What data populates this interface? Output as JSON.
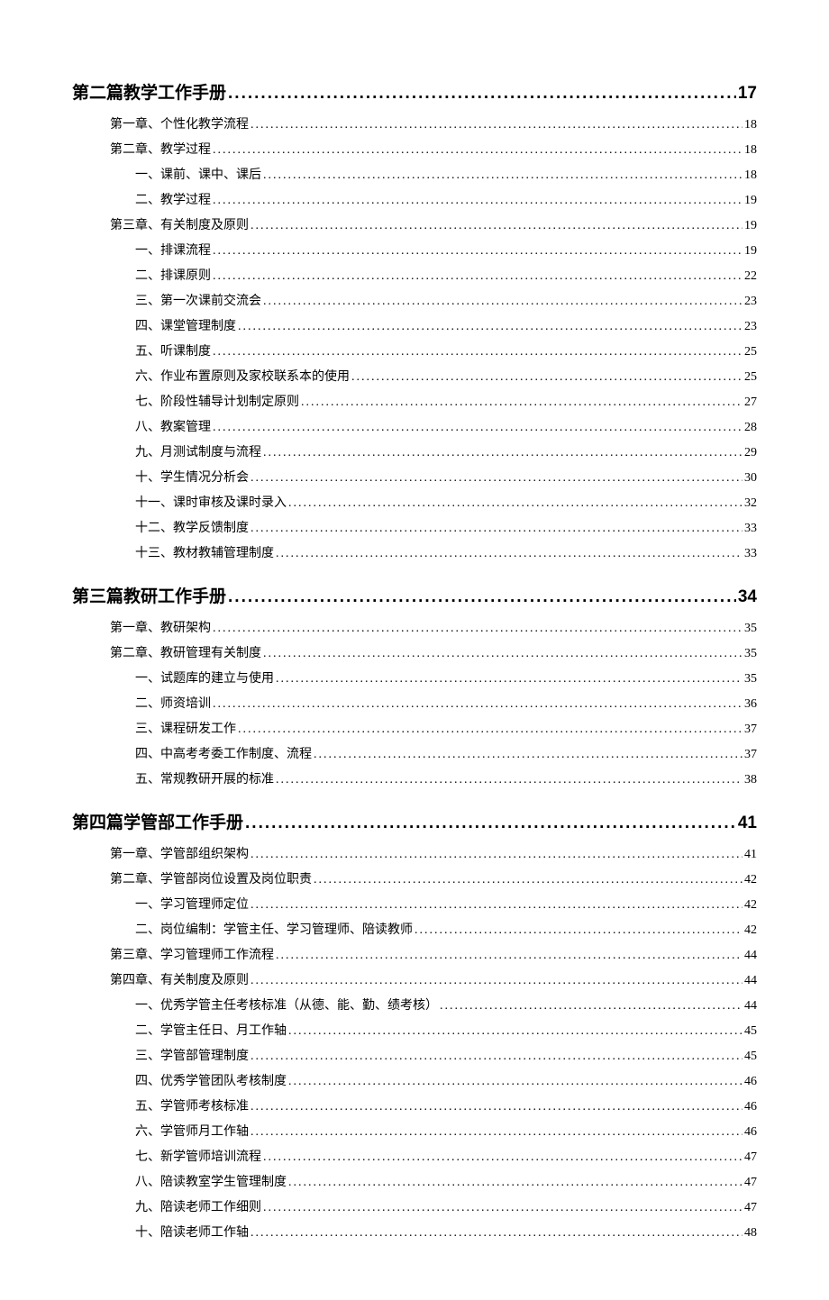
{
  "toc": [
    {
      "level": 1,
      "label": "第二篇教学工作手册",
      "page": "17"
    },
    {
      "level": 2,
      "label": "第一章、个性化教学流程",
      "page": "18"
    },
    {
      "level": 2,
      "label": "第二章、教学过程",
      "page": "18"
    },
    {
      "level": 3,
      "label": "一、课前、课中、课后",
      "page": "18"
    },
    {
      "level": 3,
      "label": "二、教学过程",
      "page": "19"
    },
    {
      "level": 2,
      "label": "第三章、有关制度及原则",
      "page": "19"
    },
    {
      "level": 3,
      "label": "一、排课流程",
      "page": "19"
    },
    {
      "level": 3,
      "label": "二、排课原则",
      "page": "22"
    },
    {
      "level": 3,
      "label": "三、第一次课前交流会",
      "page": "23"
    },
    {
      "level": 3,
      "label": "四、课堂管理制度",
      "page": "23"
    },
    {
      "level": 3,
      "label": "五、听课制度",
      "page": "25"
    },
    {
      "level": 3,
      "label": "六、作业布置原则及家校联系本的使用",
      "page": "25"
    },
    {
      "level": 3,
      "label": "七、阶段性辅导计划制定原则",
      "page": "27"
    },
    {
      "level": 3,
      "label": "八、教案管理",
      "page": "28"
    },
    {
      "level": 3,
      "label": "九、月测试制度与流程",
      "page": "29"
    },
    {
      "level": 3,
      "label": "十、学生情况分析会",
      "page": "30"
    },
    {
      "level": 3,
      "label": "十一、课时审核及课时录入",
      "page": "32"
    },
    {
      "level": 3,
      "label": "十二、教学反馈制度",
      "page": "33"
    },
    {
      "level": 3,
      "label": "十三、教材教辅管理制度",
      "page": "33"
    },
    {
      "level": 1,
      "label": "第三篇教研工作手册",
      "page": "34"
    },
    {
      "level": 2,
      "label": "第一章、教研架构",
      "page": "35"
    },
    {
      "level": 2,
      "label": "第二章、教研管理有关制度",
      "page": "35"
    },
    {
      "level": 3,
      "label": "一、试题库的建立与使用",
      "page": "35"
    },
    {
      "level": 3,
      "label": "二、师资培训",
      "page": "36"
    },
    {
      "level": 3,
      "label": "三、课程研发工作",
      "page": "37"
    },
    {
      "level": 3,
      "label": "四、中高考考委工作制度、流程",
      "page": "37"
    },
    {
      "level": 3,
      "label": "五、常规教研开展的标准",
      "page": "38"
    },
    {
      "level": 1,
      "label": "第四篇学管部工作手册",
      "page": "41"
    },
    {
      "level": 2,
      "label": "第一章、学管部组织架构",
      "page": "41"
    },
    {
      "level": 2,
      "label": "第二章、学管部岗位设置及岗位职责",
      "page": "42"
    },
    {
      "level": 3,
      "label": "一、学习管理师定位",
      "page": "42"
    },
    {
      "level": 3,
      "label": "二、岗位编制：学管主任、学习管理师、陪读教师",
      "page": "42"
    },
    {
      "level": 2,
      "label": "第三章、学习管理师工作流程",
      "page": "44"
    },
    {
      "level": 2,
      "label": "第四章、有关制度及原则",
      "page": "44"
    },
    {
      "level": 3,
      "label": "一、优秀学管主任考核标准（从德、能、勤、绩考核）",
      "page": "44"
    },
    {
      "level": 3,
      "label": "二、学管主任日、月工作轴",
      "page": "45"
    },
    {
      "level": 3,
      "label": "三、学管部管理制度",
      "page": "45"
    },
    {
      "level": 3,
      "label": "四、优秀学管团队考核制度",
      "page": "46"
    },
    {
      "level": 3,
      "label": "五、学管师考核标准",
      "page": "46"
    },
    {
      "level": 3,
      "label": "六、学管师月工作轴",
      "page": "46"
    },
    {
      "level": 3,
      "label": "七、新学管师培训流程",
      "page": "47"
    },
    {
      "level": 3,
      "label": "八、陪读教室学生管理制度",
      "page": "47"
    },
    {
      "level": 3,
      "label": "九、陪读老师工作细则",
      "page": "47"
    },
    {
      "level": 3,
      "label": "十、陪读老师工作轴",
      "page": "48"
    }
  ]
}
